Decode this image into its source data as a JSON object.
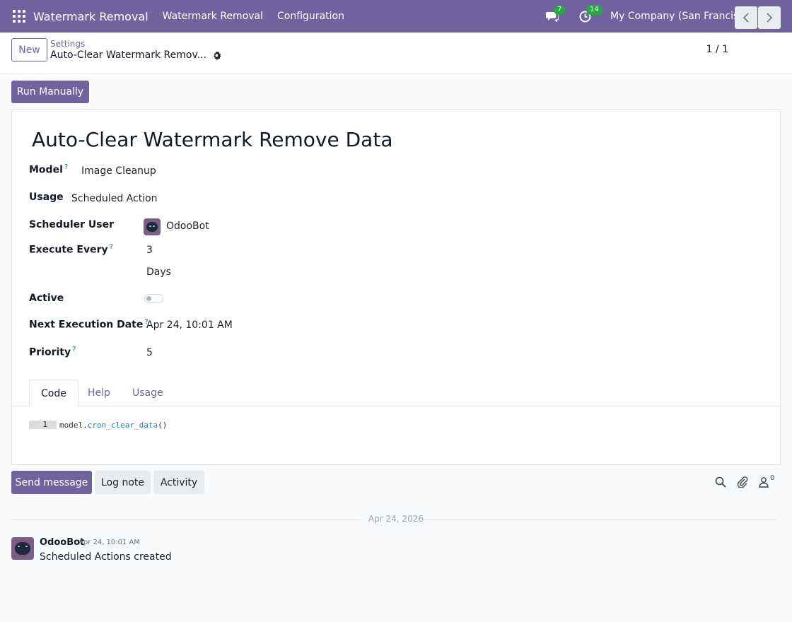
{
  "navbar": {
    "app_name": "Watermark Removal",
    "menu": [
      "Watermark Removal",
      "Configuration"
    ],
    "messages_badge": "7",
    "activities_badge": "14",
    "company": "My Company (San Francisco)"
  },
  "control_panel": {
    "new_label": "New",
    "breadcrumb_parent": "Settings",
    "breadcrumb_current": "Auto-Clear Watermark Remov...",
    "pager": "1 / 1"
  },
  "actions": {
    "run_manually": "Run Manually"
  },
  "record": {
    "title": "Auto-Clear Watermark Remove Data",
    "fields": {
      "model_label": "Model",
      "model_value": "Image Cleanup",
      "usage_label": "Usage",
      "usage_value": "Scheduled Action",
      "scheduler_user_label": "Scheduler User",
      "scheduler_user_value": "OdooBot",
      "execute_every_label": "Execute Every",
      "interval_number": "3",
      "interval_type": "Days",
      "active_label": "Active",
      "active": false,
      "next_execution_label": "Next Execution Date",
      "next_execution_value": "Apr 24, 10:01 AM",
      "priority_label": "Priority",
      "priority_value": "5",
      "help_mark": "?"
    },
    "tabs": [
      "Code",
      "Help",
      "Usage"
    ],
    "active_tab": "Code",
    "code": {
      "line_number": "1",
      "object": "model",
      "dot": ".",
      "method": "cron_clear_data",
      "parens": "()"
    }
  },
  "chatter": {
    "send_message": "Send message",
    "log_note": "Log note",
    "activity": "Activity",
    "followers_count": "0",
    "date_separator": "Apr 24, 2026",
    "messages": [
      {
        "author": "OdooBot",
        "date": "Apr 24, 10:01 AM",
        "body": "Scheduled Actions created"
      }
    ]
  },
  "colors": {
    "brand": "#71639e",
    "badge": "#28a745",
    "help": "#017e84"
  },
  "icons": [
    "apps-grid-icon",
    "chat-bubble-icon",
    "clock-icon",
    "gear-icon",
    "chevron-left-icon",
    "chevron-right-icon",
    "search-icon",
    "paperclip-icon",
    "user-icon"
  ]
}
